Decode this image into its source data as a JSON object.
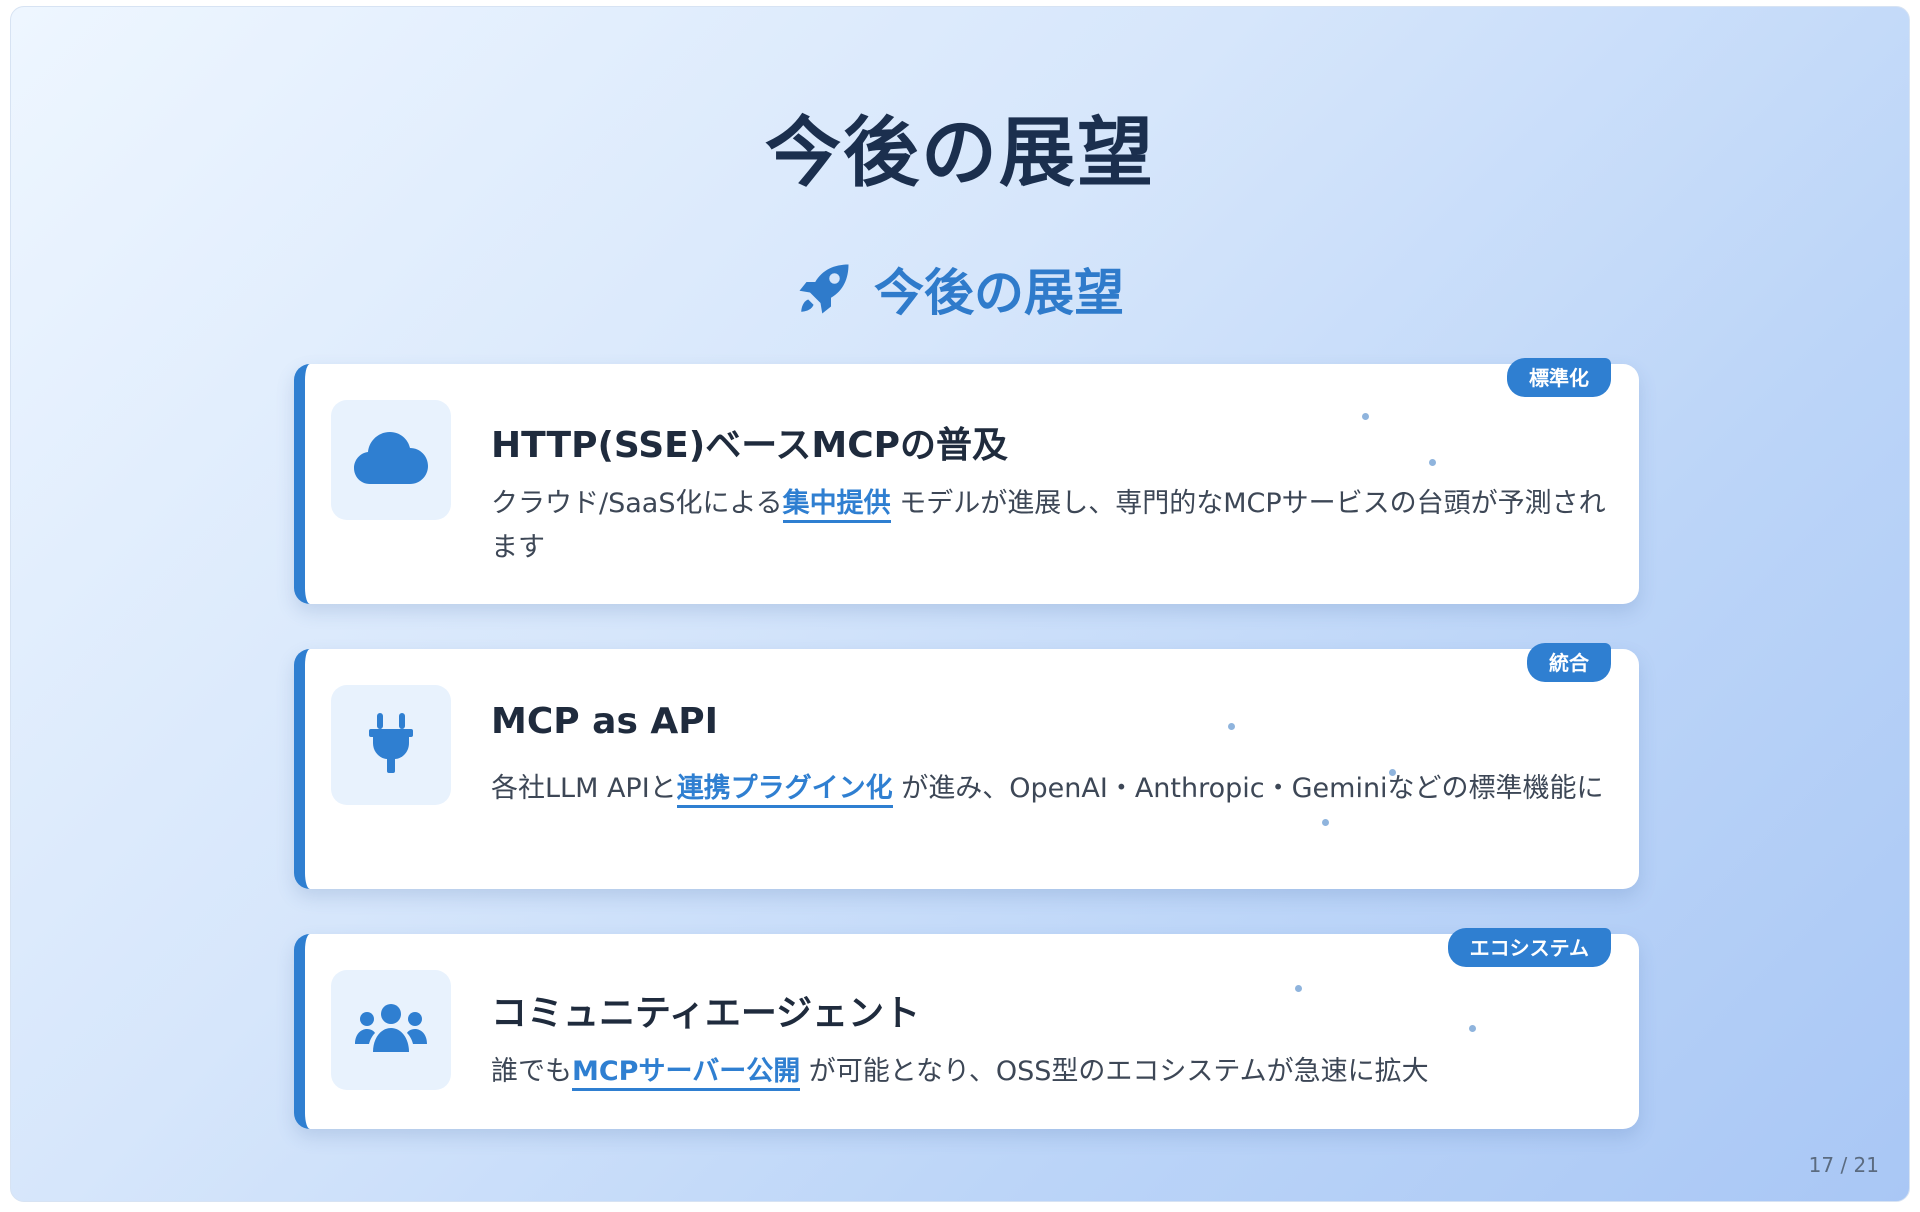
{
  "title": "今後の展望",
  "section": {
    "icon": "rocket-icon",
    "title": "今後の展望"
  },
  "cards": [
    {
      "icon": "cloud-icon",
      "badge": "標準化",
      "title": "HTTP(SSE)ベースMCPの普及",
      "desc_before": "クラウド/SaaS化による",
      "highlight": "集中提供",
      "desc_after": " モデルが進展し、専門的なMCPサービスの台頭が予測されます"
    },
    {
      "icon": "plug-icon",
      "badge": "統合",
      "title": "MCP as API",
      "desc_before": "各社LLM APIと",
      "highlight": "連携プラグイン化",
      "desc_after": " が進み、OpenAI・Anthropic・Geminiなどの標準機能に"
    },
    {
      "icon": "users-icon",
      "badge": "エコシステム",
      "title": "コミュニティエージェント",
      "desc_before": "誰でも",
      "highlight": "MCPサーバー公開",
      "desc_after": " が可能となり、OSS型のエコシステムが急速に拡大"
    }
  ],
  "colors": {
    "accent": "#2f7fd1",
    "title": "#1b2f4e",
    "icon_bg": "#e8f2fd"
  },
  "page": {
    "current": 17,
    "total": 21,
    "label": "17 / 21"
  }
}
